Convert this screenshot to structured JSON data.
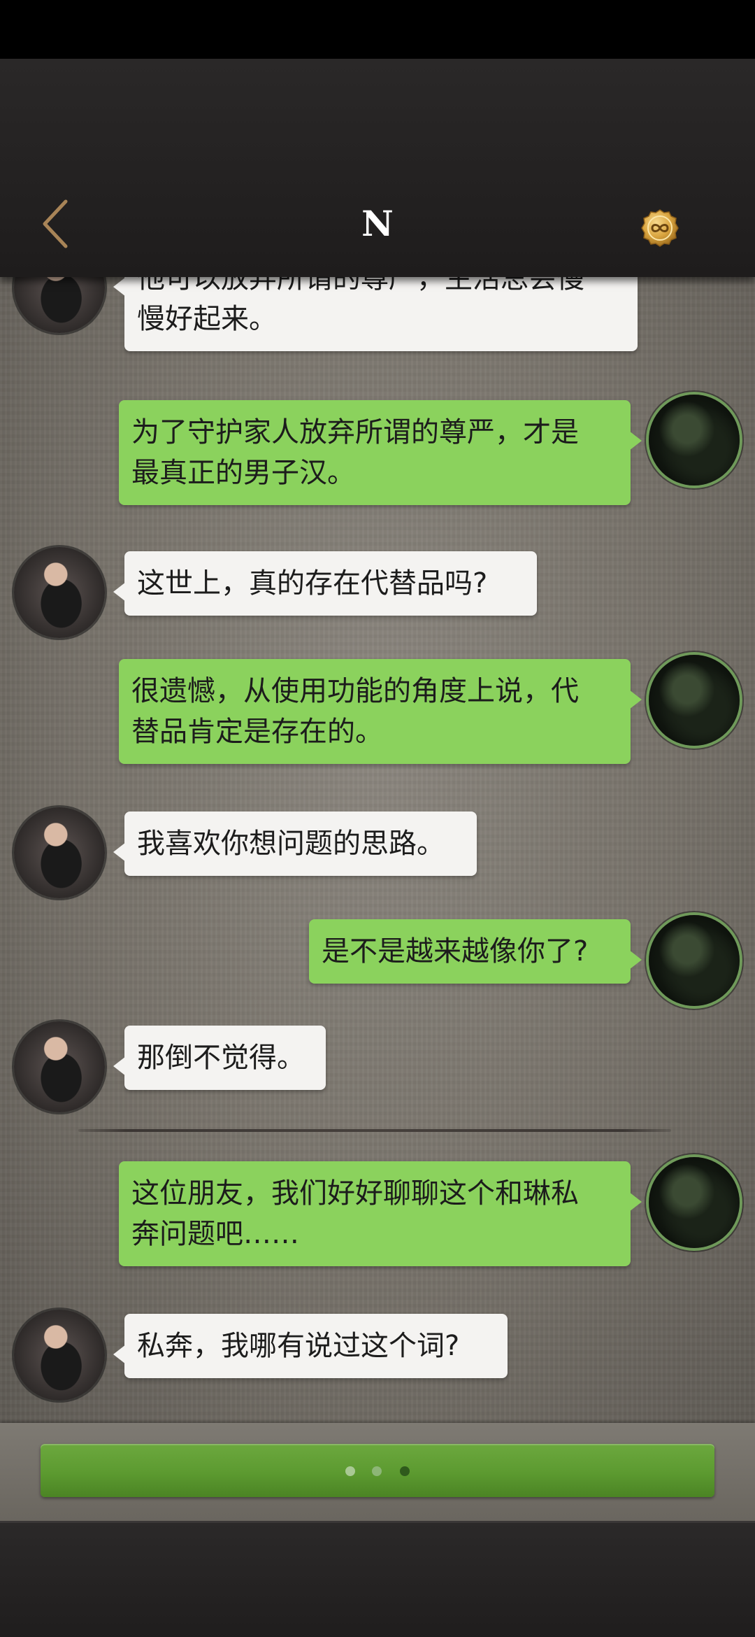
{
  "header": {
    "title": "N",
    "back_icon": "chevron-left-icon",
    "coin_icon": "infinity-coin-icon",
    "accent_color": "#b08a5a"
  },
  "messages": [
    {
      "side": "left",
      "lines": [
        "他可以放弃所谓的尊严，生活总会慢",
        "慢好起来。"
      ]
    },
    {
      "side": "right",
      "lines": [
        "为了守护家人放弃所谓的尊严，才是",
        "最真正的男子汉。"
      ]
    },
    {
      "side": "left",
      "lines": [
        "这世上，真的存在代替品吗?"
      ]
    },
    {
      "side": "right",
      "lines": [
        "很遗憾，从使用功能的角度上说，代",
        "替品肯定是存在的。"
      ]
    },
    {
      "side": "left",
      "lines": [
        "我喜欢你想问题的思路。"
      ]
    },
    {
      "side": "right",
      "lines": [
        "是不是越来越像你了?"
      ]
    },
    {
      "side": "left",
      "lines": [
        "那倒不觉得。"
      ]
    },
    {
      "side": "right",
      "lines": [
        "这位朋友，我们好好聊聊这个和琳私",
        "奔问题吧……"
      ]
    },
    {
      "side": "left",
      "lines": [
        "私奔，我哪有说过这个词?"
      ]
    }
  ],
  "colors": {
    "incoming_bubble": "#f4f3f1",
    "outgoing_bubble": "#8bd25d",
    "action_button": "#5c9a30"
  },
  "typing_indicator": {
    "dots": 3,
    "active_index": 2
  }
}
